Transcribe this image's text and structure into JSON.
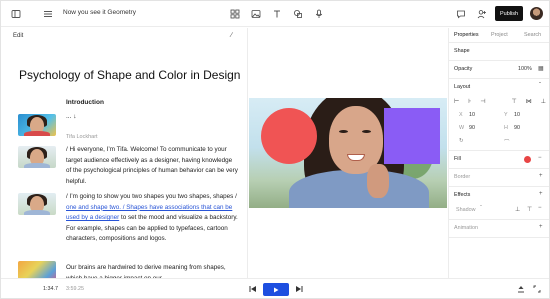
{
  "topbar": {
    "title": "Now you see it Geometry",
    "publish_label": "Publish",
    "icons": [
      "menu-icon",
      "image-icon",
      "image-icon",
      "text-icon",
      "shapes-icon",
      "microphone-icon",
      "comment-icon",
      "add-user-icon"
    ]
  },
  "script": {
    "edit_label": "Edit",
    "title": "Psychology of Shape and Color in Design",
    "intro_heading": "Introduction",
    "dots": "... ↓",
    "speaker": "Tifa Lockhart",
    "para1": "/ Hi everyone, I’m Tifa. Welcome! To communicate to your target audience effectively as a designer, having knowledge of the psychological principles of human behavior can be very helpful.",
    "para2_a": "/ I’m going to show you two shapes you two shapes, shapes / ",
    "para2_hl": "one and shape two. / Shapes have associations that can be used by a designer",
    "para2_b": " to set the mood and visualize a backstory. For example, shapes can be applied to typefaces, cartoon characters, compositions and logos.",
    "para3": "Our brains are hardwired to derive meaning from shapes, which have a bigger impact on our"
  },
  "props": {
    "tabs": [
      "Properties",
      "Project",
      "Search"
    ],
    "section_shape": "Shape",
    "opacity_label": "Opacity",
    "opacity_value": "100%",
    "layout_label": "Layout",
    "x_label": "X",
    "x_value": "10",
    "y_label": "Y",
    "y_value": "10",
    "w_label": "W",
    "w_value": "90",
    "h_label": "H",
    "h_value": "90",
    "fill_label": "Fill",
    "fill_color": "#e84545",
    "border_label": "Border",
    "effects_label": "Effects",
    "shadow_label": "Shadow",
    "animation_label": "Animation"
  },
  "playback": {
    "current_time": "1:34.7",
    "total_time": "3:59.25"
  },
  "colors": {
    "accent": "#1d4fe0",
    "circle": "#f05454",
    "square": "#8a5cf5"
  }
}
